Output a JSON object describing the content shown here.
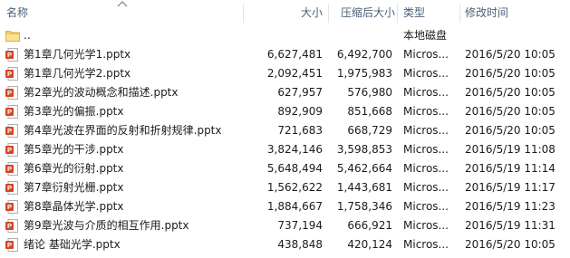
{
  "columns": {
    "name": "名称",
    "size": "大小",
    "compressed": "压缩后大小",
    "type": "类型",
    "modified": "修改时间"
  },
  "parent_row": {
    "name": "..",
    "type": "本地磁盘"
  },
  "files": [
    {
      "name": "第1章几何光学1.pptx",
      "size": "6,627,481",
      "compressed": "6,492,700",
      "type": "Micros...",
      "modified": "2016/5/20 10:05"
    },
    {
      "name": "第1章几何光学2.pptx",
      "size": "2,092,451",
      "compressed": "1,975,983",
      "type": "Micros...",
      "modified": "2016/5/20 10:05"
    },
    {
      "name": "第2章光的波动概念和描述.pptx",
      "size": "627,957",
      "compressed": "576,980",
      "type": "Micros...",
      "modified": "2016/5/20 10:05"
    },
    {
      "name": "第3章光的偏振.pptx",
      "size": "892,909",
      "compressed": "851,668",
      "type": "Micros...",
      "modified": "2016/5/20 10:05"
    },
    {
      "name": "第4章光波在界面的反射和折射规律.pptx",
      "size": "721,683",
      "compressed": "668,729",
      "type": "Micros...",
      "modified": "2016/5/20 10:05"
    },
    {
      "name": "第5章光的干涉.pptx",
      "size": "3,824,146",
      "compressed": "3,598,853",
      "type": "Micros...",
      "modified": "2016/5/19 11:08"
    },
    {
      "name": "第6章光的衍射.pptx",
      "size": "5,648,494",
      "compressed": "5,462,664",
      "type": "Micros...",
      "modified": "2016/5/19 11:14"
    },
    {
      "name": "第7章衍射光栅.pptx",
      "size": "1,562,622",
      "compressed": "1,443,681",
      "type": "Micros...",
      "modified": "2016/5/19 11:17"
    },
    {
      "name": "第8章晶体光学.pptx",
      "size": "1,884,667",
      "compressed": "1,758,346",
      "type": "Micros...",
      "modified": "2016/5/19 11:23"
    },
    {
      "name": "第9章光波与介质的相互作用.pptx",
      "size": "737,194",
      "compressed": "666,921",
      "type": "Micros...",
      "modified": "2016/5/19 11:31"
    },
    {
      "name": "绪论 基础光学.pptx",
      "size": "438,848",
      "compressed": "420,124",
      "type": "Micros...",
      "modified": "2016/5/20 10:05"
    }
  ],
  "icons": {
    "sort": "sort-ascending-icon",
    "folder": "folder-up-icon",
    "file": "powerpoint-file-icon"
  },
  "colors": {
    "header_text": "#4c607a",
    "ppt_red": "#d24726",
    "folder_yellow": "#f8d775"
  }
}
